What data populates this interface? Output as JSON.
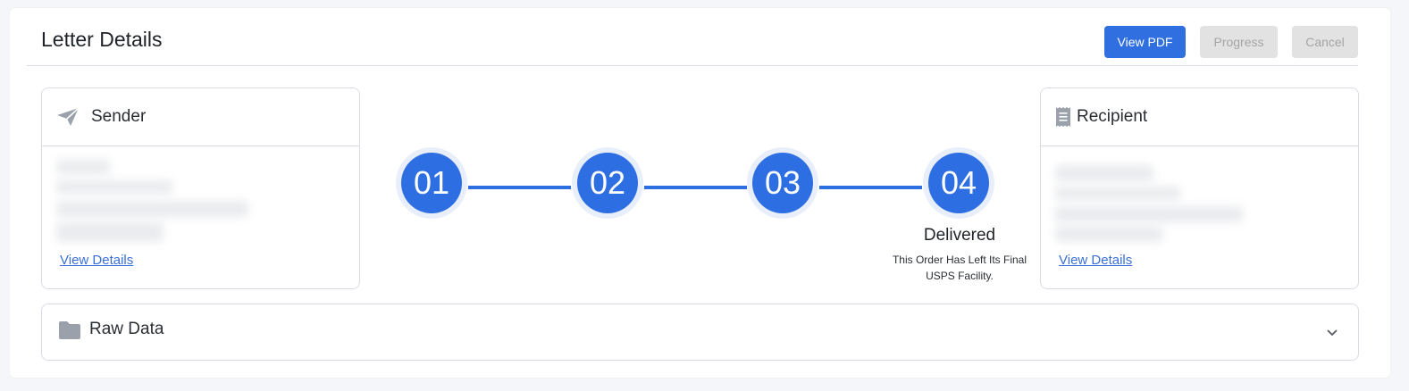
{
  "header": {
    "title": "Letter Details",
    "buttons": {
      "view_pdf": "View PDF",
      "progress": "Progress",
      "cancel": "Cancel"
    }
  },
  "sender": {
    "title": "Sender",
    "icon": "paper-plane-icon",
    "link": "View Details"
  },
  "recipient": {
    "title": "Recipient",
    "icon": "receipt-icon",
    "link": "View Details"
  },
  "steps": {
    "items": [
      {
        "number": "01"
      },
      {
        "number": "02"
      },
      {
        "number": "03"
      },
      {
        "number": "04"
      }
    ],
    "current": {
      "title": "Delivered",
      "description": "This Order Has Left Its Final USPS Facility."
    }
  },
  "raw_data": {
    "title": "Raw Data",
    "icon": "folder-icon",
    "toggle_icon": "chevron-down-icon"
  },
  "colors": {
    "accent": "#2e6ee3",
    "primary_button": "#2f6fe0",
    "disabled_button": "#e2e2e2",
    "link": "#3a6fd8",
    "icon_gray": "#9aa1ab"
  }
}
